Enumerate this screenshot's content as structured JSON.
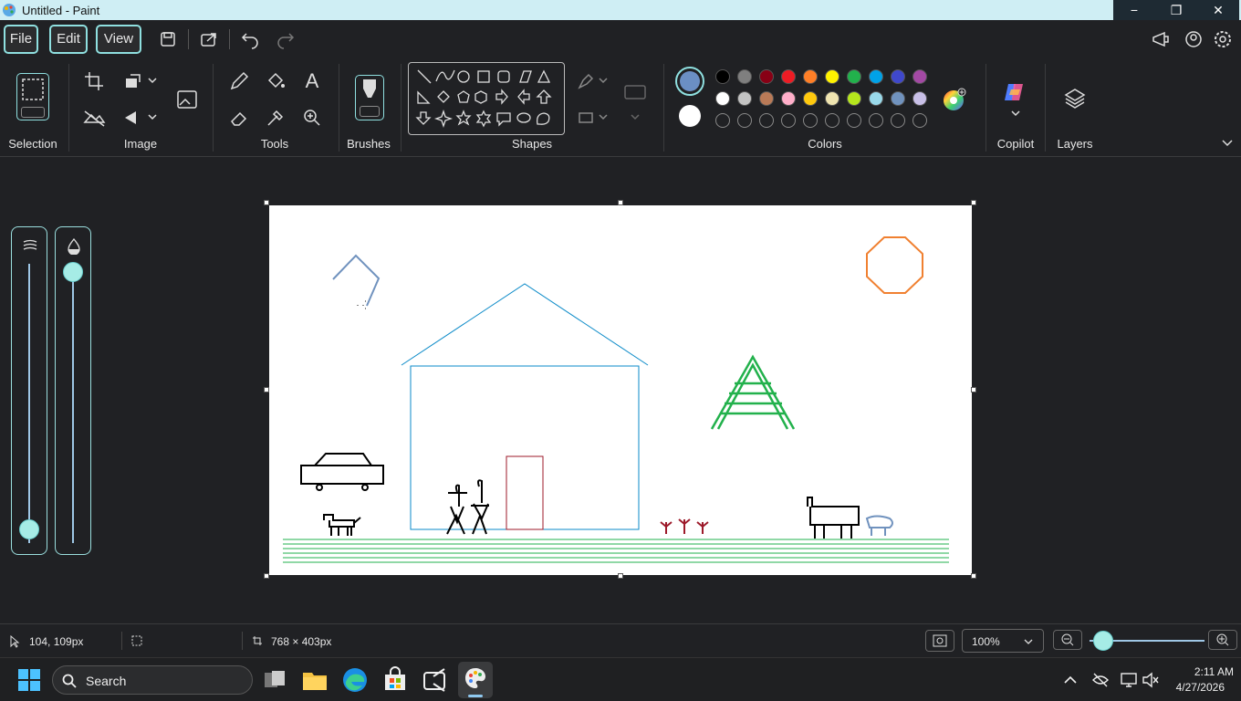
{
  "window": {
    "title": "Untitled - Paint",
    "controls": {
      "minimize": "−",
      "maximize": "❐",
      "close": "✕"
    }
  },
  "menu": {
    "file": "File",
    "edit": "Edit",
    "view": "View"
  },
  "ribbon": {
    "groups": {
      "selection": "Selection",
      "image": "Image",
      "tools": "Tools",
      "brushes": "Brushes",
      "shapes": "Shapes",
      "colors": "Colors",
      "copilot": "Copilot",
      "layers": "Layers"
    },
    "tool_text_icon": "A",
    "primary_color": "#6b8fc4",
    "secondary_color": "#ffffff",
    "palette_row1": [
      "#000000",
      "#7f7f7f",
      "#880015",
      "#ed1c24",
      "#ff7f27",
      "#fff200",
      "#22b14c",
      "#00a2e8",
      "#3f48cc",
      "#a349a4"
    ],
    "palette_row2": [
      "#ffffff",
      "#c3c3c3",
      "#b97a57",
      "#ffaec9",
      "#ffc90e",
      "#efe4b0",
      "#b5e61d",
      "#99d9ea",
      "#7092be",
      "#c8bfe7"
    ]
  },
  "status": {
    "cursor_position": "104, 109px",
    "canvas_size": "768 × 403px",
    "zoom": "100%"
  },
  "taskbar": {
    "search_placeholder": "Search",
    "time": "2:11 AM",
    "date": "4/27/2026"
  }
}
